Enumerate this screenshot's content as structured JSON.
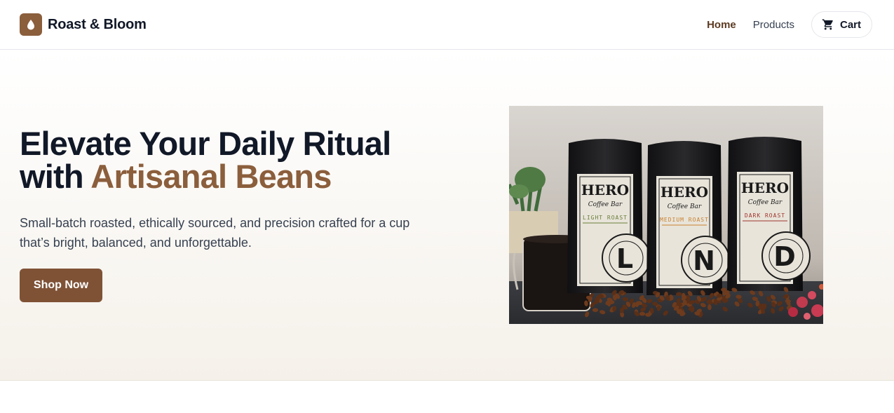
{
  "header": {
    "brand": "Roast & Bloom",
    "logo_icon": "droplet-icon",
    "nav": [
      {
        "label": "Home",
        "active": true
      },
      {
        "label": "Products",
        "active": false
      }
    ],
    "cart": {
      "label": "Cart",
      "icon": "cart-icon"
    }
  },
  "hero": {
    "title_line1": "Elevate Your Daily Ritual",
    "title_prefix": "with ",
    "title_accent": "Artisanal Beans",
    "subtitle": "Small-batch roasted, ethically sourced, and precision crafted for a cup that’s bright, balanced, and unforgettable.",
    "cta": "Shop Now",
    "image": {
      "bags": [
        {
          "brand": "HERO",
          "script": "Coffee Bar",
          "roast": "LIGHT ROAST",
          "letter": "L",
          "color": "#6b7f3a"
        },
        {
          "brand": "HERO",
          "script": "Coffee Bar",
          "roast": "MEDIUM ROAST",
          "letter": "N",
          "color": "#c9822f"
        },
        {
          "brand": "HERO",
          "script": "Coffee Bar",
          "roast": "DARK ROAST",
          "letter": "D",
          "color": "#a0342c"
        }
      ]
    }
  },
  "colors": {
    "accent": "#8b5e3c",
    "button": "#7f5236",
    "nav_active": "#5b3a22"
  }
}
